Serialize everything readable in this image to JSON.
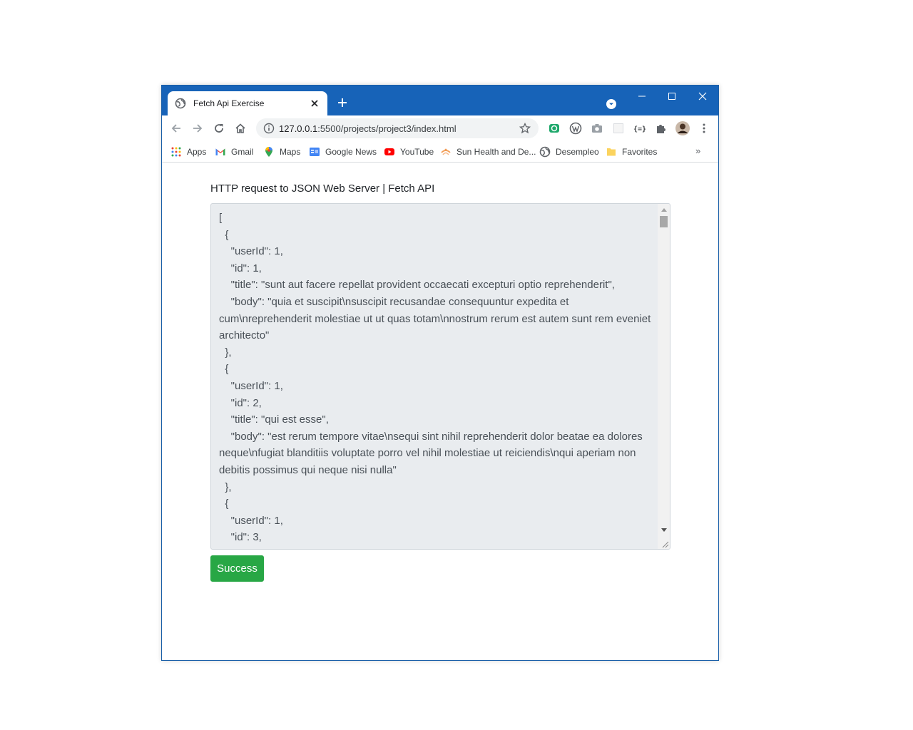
{
  "browser": {
    "tab_title": "Fetch Api Exercise",
    "url_host": "127.0.0.1",
    "url_rest": ":5500/projects/project3/index.html",
    "accent_color": "#1763b8"
  },
  "bookmarks": [
    {
      "label": "Apps",
      "icon": "apps-grid-icon"
    },
    {
      "label": "Gmail",
      "icon": "gmail-icon"
    },
    {
      "label": "Maps",
      "icon": "maps-pin-icon"
    },
    {
      "label": "Google News",
      "icon": "google-news-icon"
    },
    {
      "label": "YouTube",
      "icon": "youtube-icon"
    },
    {
      "label": "Sun Health and De...",
      "icon": "sun-health-icon"
    },
    {
      "label": "Desempleo",
      "icon": "globe-icon"
    },
    {
      "label": "Favorites",
      "icon": "folder-icon"
    }
  ],
  "page": {
    "heading": "HTTP request to JSON Web Server | Fetch API",
    "output_text": "[\n  {\n    \"userId\": 1,\n    \"id\": 1,\n    \"title\": \"sunt aut facere repellat provident occaecati excepturi optio reprehenderit\",\n    \"body\": \"quia et suscipit\\nsuscipit recusandae consequuntur expedita et cum\\nreprehenderit molestiae ut ut quas totam\\nnostrum rerum est autem sunt rem eveniet architecto\"\n  },\n  {\n    \"userId\": 1,\n    \"id\": 2,\n    \"title\": \"qui est esse\",\n    \"body\": \"est rerum tempore vitae\\nsequi sint nihil reprehenderit dolor beatae ea dolores neque\\nfugiat blanditiis voluptate porro vel nihil molestiae ut reiciendis\\nqui aperiam non debitis possimus qui neque nisi nulla\"\n  },\n  {\n    \"userId\": 1,\n    \"id\": 3,",
    "success_button": "Success",
    "success_color": "#28a745"
  }
}
